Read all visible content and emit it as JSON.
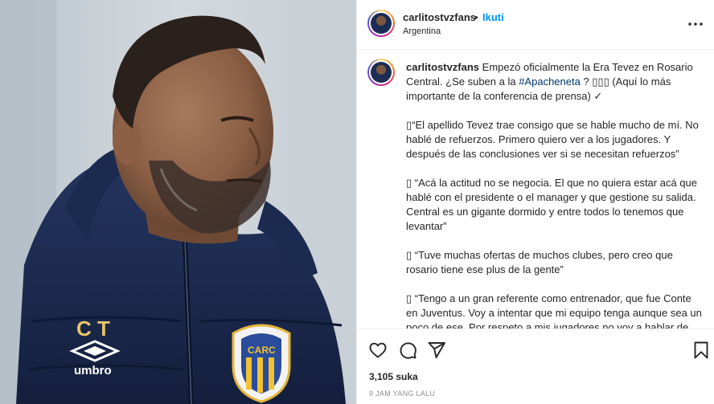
{
  "post": {
    "image_alt_icon": "photo",
    "jacket_initials": "C T",
    "jacket_brand": "umbro",
    "crest_text": "CARC"
  },
  "header": {
    "username": "carlitostvzfans",
    "separator": "•",
    "follow_label": "Ikuti",
    "location": "Argentina",
    "more_icon": "more-horizontal-icon"
  },
  "caption": {
    "username": "carlitostvzfans",
    "intro": "Empezó oficialmente la Era Tevez en Rosario Central. ¿Se suben a la ",
    "hashtag": "#Apacheneta",
    "intro_after": " ? ▯▯▯ (Aquí lo más importante de la conferencia de prensa) ✓",
    "paragraphs": [
      "▯“El apellido Tevez trae consigo que se hable mucho de mí. No hablé de refuerzos. Primero quiero ver a los jugadores. Y después de las conclusiones ver si se necesitan refuerzos”",
      "▯ “Acá la actitud no se negocia. El que no quiera estar acá que hablé con el presidente o el manager y que gestione su salida. Central es un gigante dormido y entre todos lo tenemos que levantar”",
      "▯ “Tuve muchas ofertas de muchos clubes, pero creo que rosario tiene ese plus de la gente”",
      "▯ “Tengo a un gran referente como entrenador, que fue Conte en Juventus. Voy a intentar que mi equipo tenga aunque sea un poco de ese. Por respeto a mis jugadores no voy a hablar de refuerzos. Tenemos un partido el próximo viernes”"
    ]
  },
  "actions": {
    "like_icon": "heart-icon",
    "comment_icon": "comment-icon",
    "share_icon": "send-icon",
    "save_icon": "bookmark-icon"
  },
  "stats": {
    "likes": "3,105 suka",
    "time": "9 JAM YANG LALU"
  }
}
